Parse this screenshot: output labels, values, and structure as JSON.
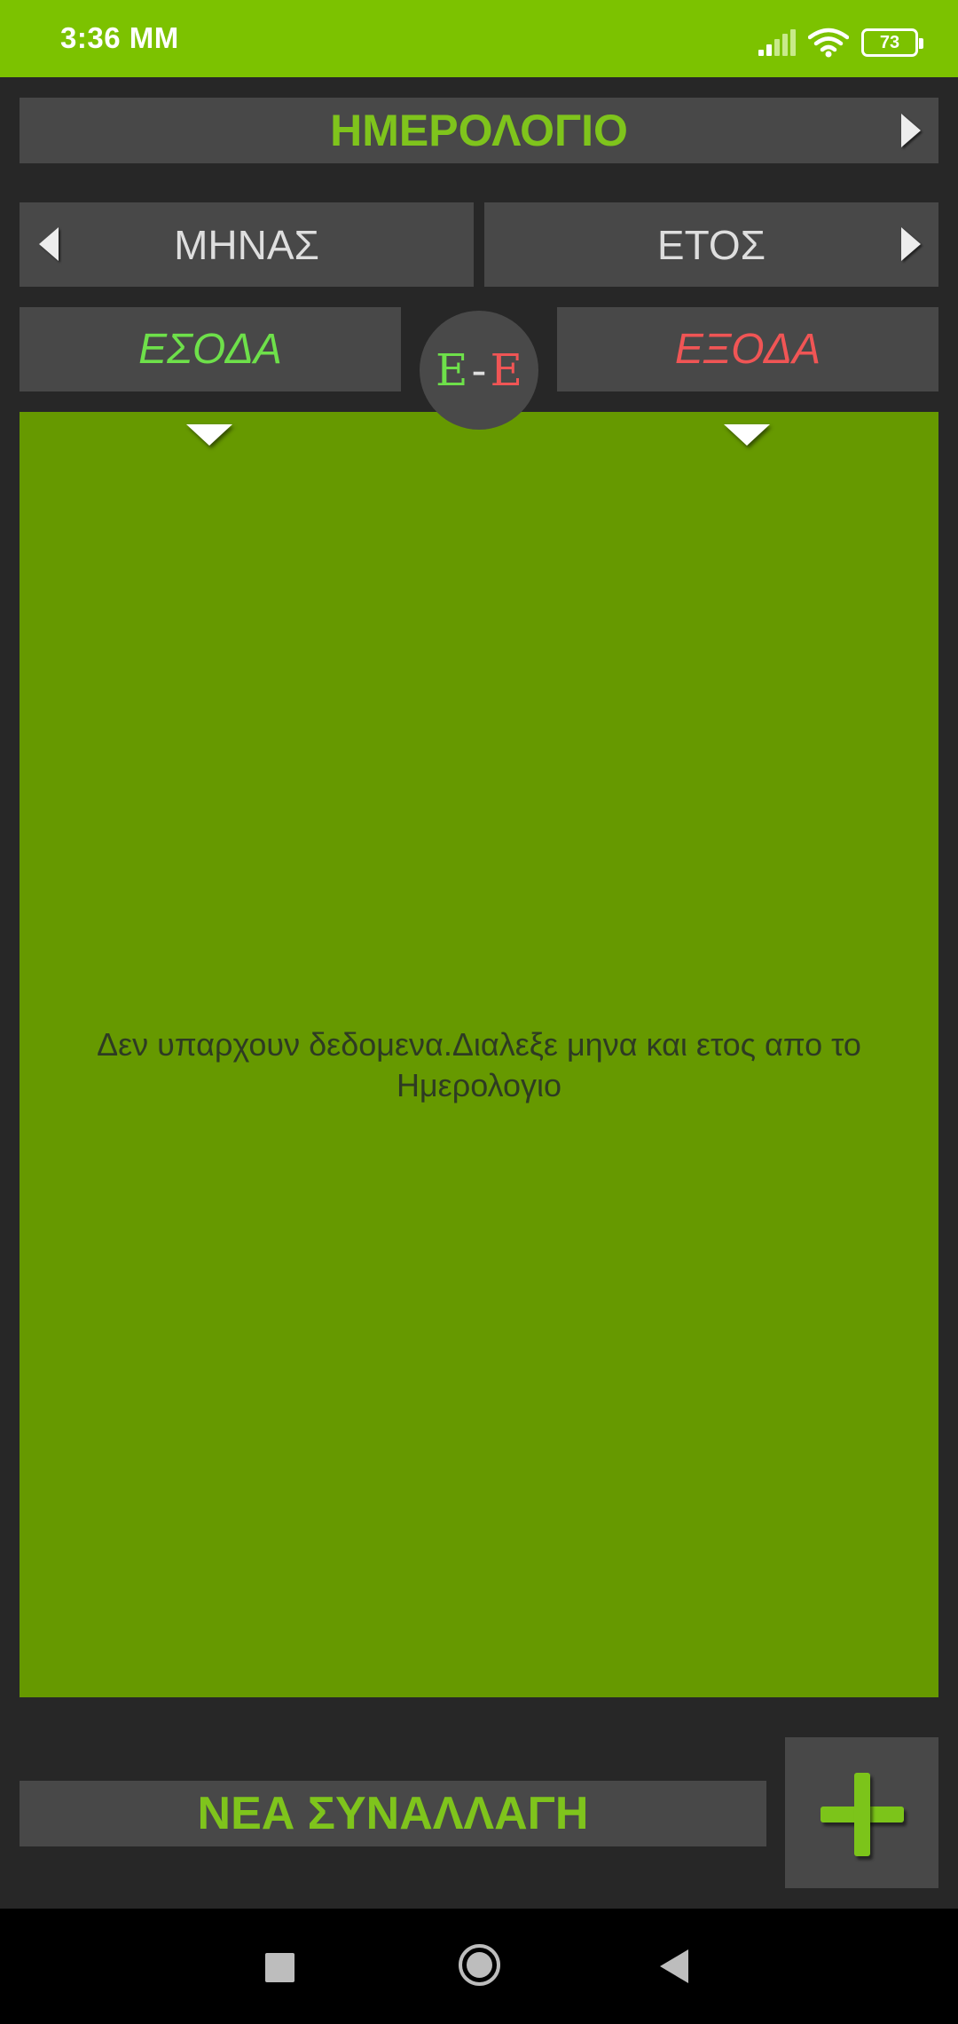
{
  "status_bar": {
    "time": "3:36 MM",
    "battery": "73"
  },
  "calendar": {
    "title": "ΗΜΕΡΟΛΟΓΙΟ"
  },
  "selectors": {
    "month_label": "ΜΗΝΑΣ",
    "year_label": "ΕΤΟΣ"
  },
  "toggle": {
    "income_label": "ΕΣΟΔΑ",
    "expense_label": "ΕΞΟΔΑ",
    "ee_left": "Ε",
    "ee_dash": "-",
    "ee_right": "Ε"
  },
  "main": {
    "empty_message": "Δεν υπαρχουν δεδομενα.Διαλεξε μηνα και ετος απο το Ημερολογιο"
  },
  "actions": {
    "new_transaction_label": "ΝΕΑ ΣΥΝΑΛΛΑΓΗ"
  },
  "colors": {
    "status_bar_bg": "#7cc200",
    "accent_green": "#7fc41c",
    "panel_green": "#669900",
    "income_green": "#6ee04a",
    "expense_red": "#f05555",
    "dark_bg": "#272727",
    "bar_bg": "#484848"
  },
  "icons": {
    "calendar_next": "triangle-right-icon",
    "month_prev": "triangle-left-icon",
    "year_next": "triangle-right-icon",
    "income_expand": "triangle-down-icon",
    "expense_expand": "triangle-down-icon",
    "add": "plus-icon"
  }
}
